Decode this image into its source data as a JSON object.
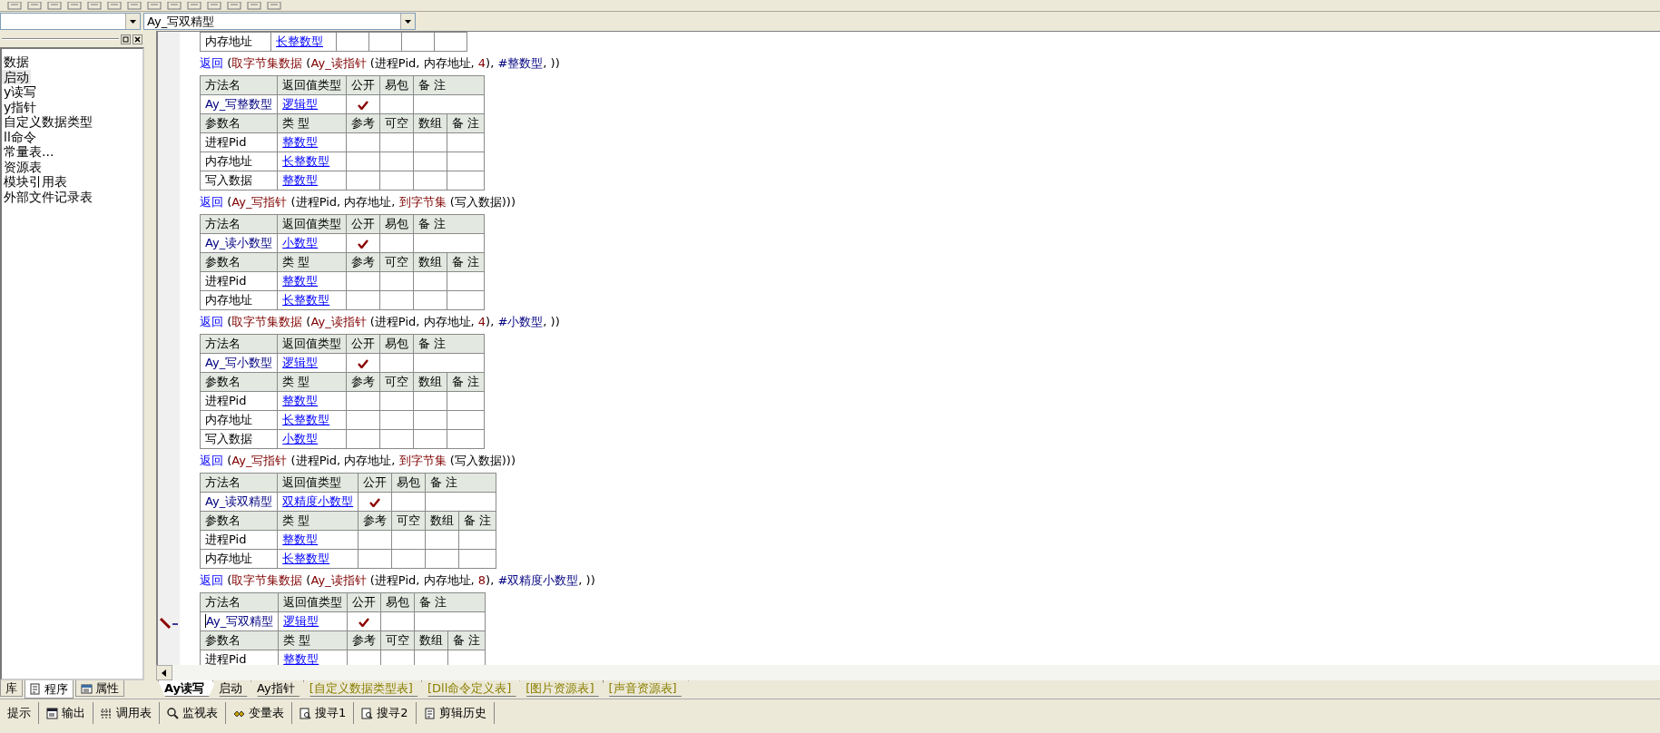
{
  "method_selector": {
    "value": "Ay_写双精型"
  },
  "project_tree": {
    "items": [
      {
        "label": "数据",
        "selected": false
      },
      {
        "label": "启动",
        "selected": true
      },
      {
        "label": "y读写",
        "selected": false
      },
      {
        "label": "y指针",
        "selected": false
      },
      {
        "label": "自定义数据类型",
        "selected": false
      },
      {
        "label": "ll命令",
        "selected": false
      },
      {
        "label": "常量表...",
        "selected": false
      },
      {
        "label": "资源表",
        "selected": false
      },
      {
        "label": "模块引用表",
        "selected": false
      },
      {
        "label": "外部文件记录表",
        "selected": false
      }
    ]
  },
  "left_tabs": [
    {
      "label": "库",
      "selected": false,
      "kind": "library"
    },
    {
      "label": "程序",
      "selected": true,
      "kind": "program"
    },
    {
      "label": "属性",
      "selected": false,
      "kind": "properties"
    }
  ],
  "code": {
    "blocks": [
      {
        "kind": "params",
        "params": [
          {
            "name": "内存地址",
            "type": "长整数型"
          }
        ]
      },
      {
        "kind": "line",
        "tokens": [
          {
            "text": "返回",
            "kind": "keyword"
          },
          {
            "text": " (",
            "kind": "plain"
          },
          {
            "text": "取字节集数据",
            "kind": "func"
          },
          {
            "text": " (",
            "kind": "plain"
          },
          {
            "text": "Ay_读指针",
            "kind": "func"
          },
          {
            "text": " (进程Pid, 内存地址, ",
            "kind": "plain"
          },
          {
            "text": "4",
            "kind": "number"
          },
          {
            "text": "), ",
            "kind": "plain"
          },
          {
            "text": "#整数型",
            "kind": "constant"
          },
          {
            "text": ", ))",
            "kind": "plain"
          }
        ]
      },
      {
        "kind": "method",
        "header": [
          "方法名",
          "返回值类型",
          "公开",
          "易包",
          "备 注"
        ],
        "name": "Ay_写整数型",
        "return_type": "逻辑型",
        "public": true,
        "editing": false,
        "param_header": [
          "参数名",
          "类 型",
          "参考",
          "可空",
          "数组",
          "备 注"
        ],
        "params": [
          {
            "name": "进程Pid",
            "type": "整数型"
          },
          {
            "name": "内存地址",
            "type": "长整数型"
          },
          {
            "name": "写入数据",
            "type": "整数型"
          }
        ]
      },
      {
        "kind": "line",
        "tokens": [
          {
            "text": "返回",
            "kind": "keyword"
          },
          {
            "text": " (",
            "kind": "plain"
          },
          {
            "text": "Ay_写指针",
            "kind": "func"
          },
          {
            "text": " (进程Pid, 内存地址, ",
            "kind": "plain"
          },
          {
            "text": "到字节集",
            "kind": "func"
          },
          {
            "text": " (写入数据)))",
            "kind": "plain"
          }
        ]
      },
      {
        "kind": "method",
        "header": [
          "方法名",
          "返回值类型",
          "公开",
          "易包",
          "备 注"
        ],
        "name": "Ay_读小数型",
        "return_type": "小数型",
        "public": true,
        "editing": false,
        "param_header": [
          "参数名",
          "类 型",
          "参考",
          "可空",
          "数组",
          "备 注"
        ],
        "params": [
          {
            "name": "进程Pid",
            "type": "整数型"
          },
          {
            "name": "内存地址",
            "type": "长整数型"
          }
        ]
      },
      {
        "kind": "line",
        "tokens": [
          {
            "text": "返回",
            "kind": "keyword"
          },
          {
            "text": " (",
            "kind": "plain"
          },
          {
            "text": "取字节集数据",
            "kind": "func"
          },
          {
            "text": " (",
            "kind": "plain"
          },
          {
            "text": "Ay_读指针",
            "kind": "func"
          },
          {
            "text": " (进程Pid, 内存地址, ",
            "kind": "plain"
          },
          {
            "text": "4",
            "kind": "number"
          },
          {
            "text": "), ",
            "kind": "plain"
          },
          {
            "text": "#小数型",
            "kind": "constant"
          },
          {
            "text": ", ))",
            "kind": "plain"
          }
        ]
      },
      {
        "kind": "method",
        "header": [
          "方法名",
          "返回值类型",
          "公开",
          "易包",
          "备 注"
        ],
        "name": "Ay_写小数型",
        "return_type": "逻辑型",
        "public": true,
        "editing": false,
        "param_header": [
          "参数名",
          "类 型",
          "参考",
          "可空",
          "数组",
          "备 注"
        ],
        "params": [
          {
            "name": "进程Pid",
            "type": "整数型"
          },
          {
            "name": "内存地址",
            "type": "长整数型"
          },
          {
            "name": "写入数据",
            "type": "小数型"
          }
        ]
      },
      {
        "kind": "line",
        "tokens": [
          {
            "text": "返回",
            "kind": "keyword"
          },
          {
            "text": " (",
            "kind": "plain"
          },
          {
            "text": "Ay_写指针",
            "kind": "func"
          },
          {
            "text": " (进程Pid, 内存地址, ",
            "kind": "plain"
          },
          {
            "text": "到字节集",
            "kind": "func"
          },
          {
            "text": " (写入数据)))",
            "kind": "plain"
          }
        ]
      },
      {
        "kind": "method",
        "header": [
          "方法名",
          "返回值类型",
          "公开",
          "易包",
          "备 注"
        ],
        "name": "Ay_读双精型",
        "return_type": "双精度小数型",
        "public": true,
        "editing": false,
        "param_header": [
          "参数名",
          "类 型",
          "参考",
          "可空",
          "数组",
          "备 注"
        ],
        "params": [
          {
            "name": "进程Pid",
            "type": "整数型"
          },
          {
            "name": "内存地址",
            "type": "长整数型"
          }
        ]
      },
      {
        "kind": "line",
        "tokens": [
          {
            "text": "返回",
            "kind": "keyword"
          },
          {
            "text": " (",
            "kind": "plain"
          },
          {
            "text": "取字节集数据",
            "kind": "func"
          },
          {
            "text": " (",
            "kind": "plain"
          },
          {
            "text": "Ay_读指针",
            "kind": "func"
          },
          {
            "text": " (进程Pid, 内存地址, ",
            "kind": "plain"
          },
          {
            "text": "8",
            "kind": "number"
          },
          {
            "text": "), ",
            "kind": "plain"
          },
          {
            "text": "#双精度小数型",
            "kind": "constant"
          },
          {
            "text": ", ))",
            "kind": "plain"
          }
        ]
      },
      {
        "kind": "method",
        "header": [
          "方法名",
          "返回值类型",
          "公开",
          "易包",
          "备 注"
        ],
        "name": "Ay_写双精型",
        "return_type": "逻辑型",
        "public": true,
        "editing": true,
        "param_header": [
          "参数名",
          "类 型",
          "参考",
          "可空",
          "数组",
          "备 注"
        ],
        "params": [
          {
            "name": "进程Pid",
            "type": "整数型"
          }
        ]
      }
    ]
  },
  "editor_tabs": [
    {
      "label": "Ay读写",
      "selected": true,
      "kind": "code"
    },
    {
      "label": "启动",
      "selected": false,
      "kind": "code"
    },
    {
      "label": "Ay指针",
      "selected": false,
      "kind": "code"
    },
    {
      "label": "[自定义数据类型表]",
      "selected": false,
      "kind": "table"
    },
    {
      "label": "[Dll命令定义表]",
      "selected": false,
      "kind": "table"
    },
    {
      "label": "[图片资源表]",
      "selected": false,
      "kind": "table"
    },
    {
      "label": "[声音资源表]",
      "selected": false,
      "kind": "table"
    }
  ],
  "tool_windows": [
    {
      "label": "提示",
      "kind": "hint"
    },
    {
      "label": "输出",
      "kind": "output"
    },
    {
      "label": "调用表",
      "kind": "calls"
    },
    {
      "label": "监视表",
      "kind": "watch"
    },
    {
      "label": "变量表",
      "kind": "variables"
    },
    {
      "label": "搜寻1",
      "kind": "search"
    },
    {
      "label": "搜寻2",
      "kind": "search"
    },
    {
      "label": "剪辑历史",
      "kind": "clipboard"
    }
  ]
}
